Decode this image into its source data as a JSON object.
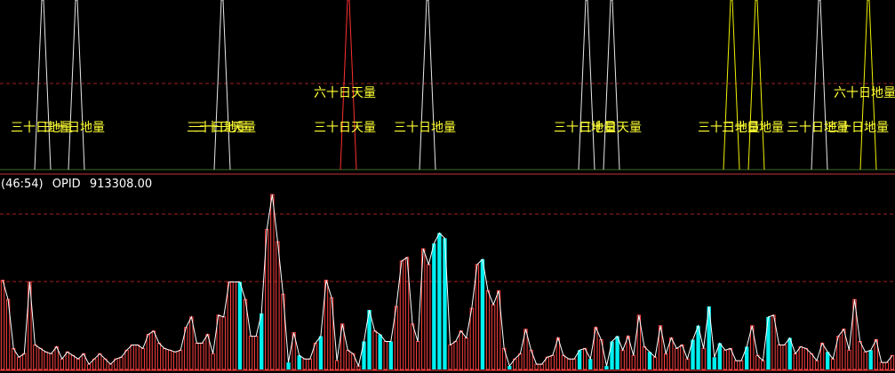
{
  "colors": {
    "background": "#000000",
    "divider": "#c8323a",
    "dashed": "#a02020",
    "spike_white": "#e8e8e8",
    "spike_yellow": "#f0f000",
    "spike_red": "#ff3030",
    "label_yellow": "#ffff33",
    "bar_red": "#ff4040",
    "bar_cyan": "#00f0f0",
    "line_white": "#ffffff"
  },
  "header": {
    "period": "(46:54)",
    "indicator": "OPID",
    "value": "913308.00"
  },
  "chart_data": [
    {
      "type": "line",
      "name": "upper-panel-signals",
      "ylim": [
        0,
        100
      ],
      "grid": "dashed-horizontal",
      "spikes": [
        {
          "x": 48,
          "color": "white"
        },
        {
          "x": 86,
          "color": "white"
        },
        {
          "x": 250,
          "color": "white"
        },
        {
          "x": 392,
          "color": "red"
        },
        {
          "x": 481,
          "color": "white"
        },
        {
          "x": 660,
          "color": "white"
        },
        {
          "x": 688,
          "color": "white"
        },
        {
          "x": 823,
          "color": "yellow"
        },
        {
          "x": 851,
          "color": "yellow"
        },
        {
          "x": 922,
          "color": "white"
        },
        {
          "x": 977,
          "color": "yellow"
        }
      ],
      "labels": [
        {
          "text": "三十日地量",
          "x": 12,
          "row": 2
        },
        {
          "text": "三十日地量",
          "x": 48,
          "row": 2
        },
        {
          "text": "三十日地量",
          "x": 210,
          "row": 2
        },
        {
          "text": "三十日天量",
          "x": 218,
          "row": 2
        },
        {
          "text": "六十日天量",
          "x": 353,
          "row": 1
        },
        {
          "text": "三十日天量",
          "x": 353,
          "row": 2
        },
        {
          "text": "三十日地量",
          "x": 443,
          "row": 2
        },
        {
          "text": "三十日地量",
          "x": 623,
          "row": 2
        },
        {
          "text": "三十日天量",
          "x": 652,
          "row": 2
        },
        {
          "text": "三十日地量",
          "x": 785,
          "row": 2
        },
        {
          "text": "三十日地量",
          "x": 812,
          "row": 2
        },
        {
          "text": "三十日地量",
          "x": 885,
          "row": 2
        },
        {
          "text": "三十日地量",
          "x": 930,
          "row": 2
        },
        {
          "text": "六十日地量",
          "x": 938,
          "row": 1
        }
      ]
    },
    {
      "type": "bar",
      "name": "OPID",
      "ylim": [
        0,
        100
      ],
      "grid": "dashed-horizontal",
      "series": [
        {
          "name": "OPID",
          "values": [
            51,
            40,
            12,
            7,
            9,
            50,
            14,
            12,
            10,
            9,
            13,
            6,
            10,
            8,
            6,
            9,
            3,
            6,
            9,
            6,
            3,
            6,
            7,
            11,
            14,
            14,
            12,
            20,
            22,
            15,
            12,
            11,
            10,
            11,
            24,
            30,
            15,
            15,
            20,
            9,
            31,
            30,
            50,
            50,
            50,
            40,
            19,
            19,
            32,
            80,
            100,
            73,
            43,
            4,
            21,
            8,
            6,
            6,
            15,
            19,
            51,
            41,
            5,
            26,
            11,
            9,
            2,
            16,
            34,
            22,
            20,
            16,
            16,
            36,
            62,
            64,
            26,
            16,
            69,
            60,
            72,
            78,
            75,
            14,
            16,
            22,
            18,
            35,
            60,
            63,
            45,
            37,
            45,
            12,
            2,
            6,
            9,
            23,
            11,
            3,
            3,
            7,
            8,
            18,
            8,
            6,
            6,
            11,
            12,
            6,
            24,
            17,
            2,
            16,
            19,
            11,
            19,
            8,
            31,
            13,
            10,
            7,
            25,
            9,
            18,
            12,
            14,
            6,
            17,
            25,
            12,
            36,
            7,
            15,
            11,
            12,
            5,
            5,
            13,
            25,
            8,
            5,
            30,
            31,
            14,
            14,
            18,
            9,
            13,
            12,
            9,
            5,
            15,
            10,
            6,
            19,
            23,
            11,
            40,
            16,
            10,
            11,
            17,
            4,
            4,
            8
          ],
          "colors": "rrrrrrrrrrrrrrrrrrrrrrrrrrrrrrrrrrrrrrrrrrrrcrrrcrrrrcrcrrrcrrrrrrrccrcrcrrrrrrrcccrrrrrrcrrrrcrrrrrrrrrrrrcrcrrcccrrrrrcrrrrrrrccrcccrrrrcrrrcrrrcrrrrrrcrrrrrrrcrrrrcrrrcrrrrrrrr"
        }
      ]
    }
  ]
}
